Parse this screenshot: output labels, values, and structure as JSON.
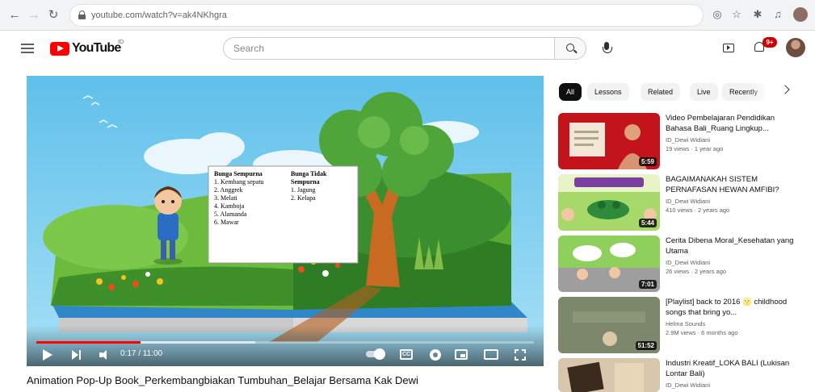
{
  "browser": {
    "url": "youtube.com/watch?v=ak4NKhgra",
    "icons": [
      "back-icon",
      "forward-icon",
      "reload-icon",
      "lock-icon",
      "extension-icon",
      "bookmark-star-icon",
      "puzzle-icon",
      "media-icon",
      "profile-avatar"
    ]
  },
  "masthead": {
    "logo_text": "YouTube",
    "country_code": "ID",
    "search_placeholder": "Search",
    "notification_count": "9+"
  },
  "player": {
    "time": "0:17 / 11:00",
    "played_fraction": 0.21,
    "buffered_fraction": 0.44,
    "cc_label": "CC",
    "board": {
      "col1_title": "Bunga Sempurna",
      "col1_items": [
        "1. Kembang sepatu",
        "2. Anggrek",
        "3. Melati",
        "4. Kamboja",
        "5. Alamanda",
        "6. Mawar"
      ],
      "col2_title": "Bunga Tidak Sempurna",
      "col2_items": [
        "1. Jagung",
        "2. Kelapa"
      ]
    }
  },
  "video_title": "Animation Pop-Up Book_Perkembangbiakan Tumbuhan_Belajar Bersama Kak Dewi",
  "chips": [
    "All",
    "Lessons",
    "Related",
    "Live",
    "Recently"
  ],
  "recommendations": [
    {
      "title": "Video Pembelajaran Pendidikan Bahasa Bali_Ruang Lingkup...",
      "channel": "ID_Dewi Widiani",
      "meta": "19 views · 1 year ago",
      "duration": "5:59"
    },
    {
      "title": "BAGAIMANAKAH SISTEM PERNAFASAN HEWAN AMFIBI?",
      "channel": "ID_Dewi Widiani",
      "meta": "410 views · 2 years ago",
      "duration": "5:44"
    },
    {
      "title": "Cerita Dibena Moral_Kesehatan yang Utama",
      "channel": "ID_Dewi Widiani",
      "meta": "26 views · 2 years ago",
      "duration": "7:01"
    },
    {
      "title": "[Playlist] back to 2016 🌝 childhood songs that bring yo...",
      "channel": "Helma Sounds",
      "meta": "2.9M views · 6 months ago",
      "duration": "51:52"
    },
    {
      "title": "Industri Kreatif_LOKA BALI (Lukisan Lontar Bali)",
      "channel": "ID_Dewi Widiani",
      "meta": "",
      "duration": ""
    }
  ]
}
